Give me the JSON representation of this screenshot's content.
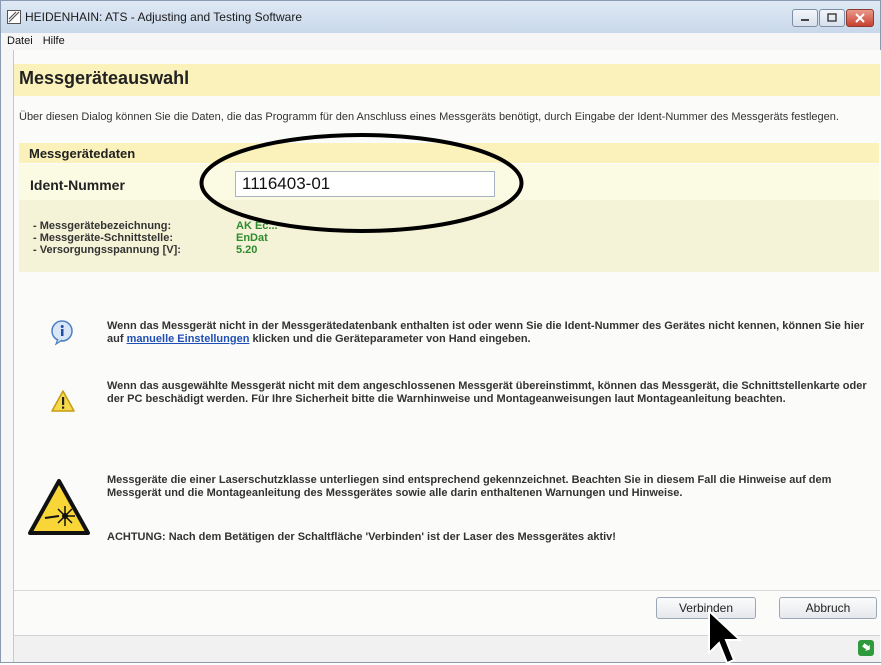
{
  "window": {
    "title": "HEIDENHAIN: ATS - Adjusting and Testing Software",
    "menu": [
      "Datei",
      "Hilfe"
    ]
  },
  "page": {
    "title": "Messgeräteauswahl",
    "intro": "Über diesen Dialog können Sie die Daten, die das Programm für den Anschluss eines Messgeräts benötigt, durch Eingabe der Ident-Nummer des Messgeräts festlegen."
  },
  "device": {
    "section_title": "Messgerätedaten",
    "ident_label": "Ident-Nummer",
    "ident_value": "1116403-01",
    "details": [
      {
        "label": "- Messgerätebezeichnung:",
        "value": "AK Ec..."
      },
      {
        "label": "- Messgeräte-Schnittstelle:",
        "value": "EnDat"
      },
      {
        "label": "- Versorgungsspannung [V]:",
        "value": "5.20"
      }
    ]
  },
  "notes": {
    "info_before": "Wenn das Messgerät nicht in der Messgerätedatenbank enthalten ist oder wenn Sie die Ident-Nummer des Gerätes nicht kennen, können Sie hier auf ",
    "info_link": "manuelle Einstellungen",
    "info_after": " klicken und die Geräteparameter von Hand eingeben.",
    "warning": "Wenn das ausgewählte Messgerät nicht mit dem angeschlossenen Messgerät übereinstimmt, können das Messgerät, die Schnittstellenkarte oder der PC beschädigt werden. Für Ihre Sicherheit bitte die Warnhinweise und Montageanweisungen laut Montageanleitung beachten.",
    "laser": "Messgeräte die einer Laserschutzklasse unterliegen sind entsprechend gekennzeichnet. Beachten Sie in diesem Fall die Hinweise auf dem Messgerät und die Montageanleitung des Messgerätes sowie alle darin enthaltenen Warnungen und Hinweise.",
    "laser_warning": "ACHTUNG: Nach dem Betätigen der Schaltfläche 'Verbinden' ist der Laser des Messgerätes aktiv!"
  },
  "buttons": {
    "connect": "Verbinden",
    "cancel": "Abbruch"
  },
  "icons": {
    "info": "info-icon",
    "warning": "warning-icon",
    "laser": "laser-warning-icon",
    "status": "status-icon"
  },
  "colors": {
    "header_bg": "#faf1bb",
    "value_green": "#2e8b2e",
    "link_blue": "#1f4fb5"
  }
}
